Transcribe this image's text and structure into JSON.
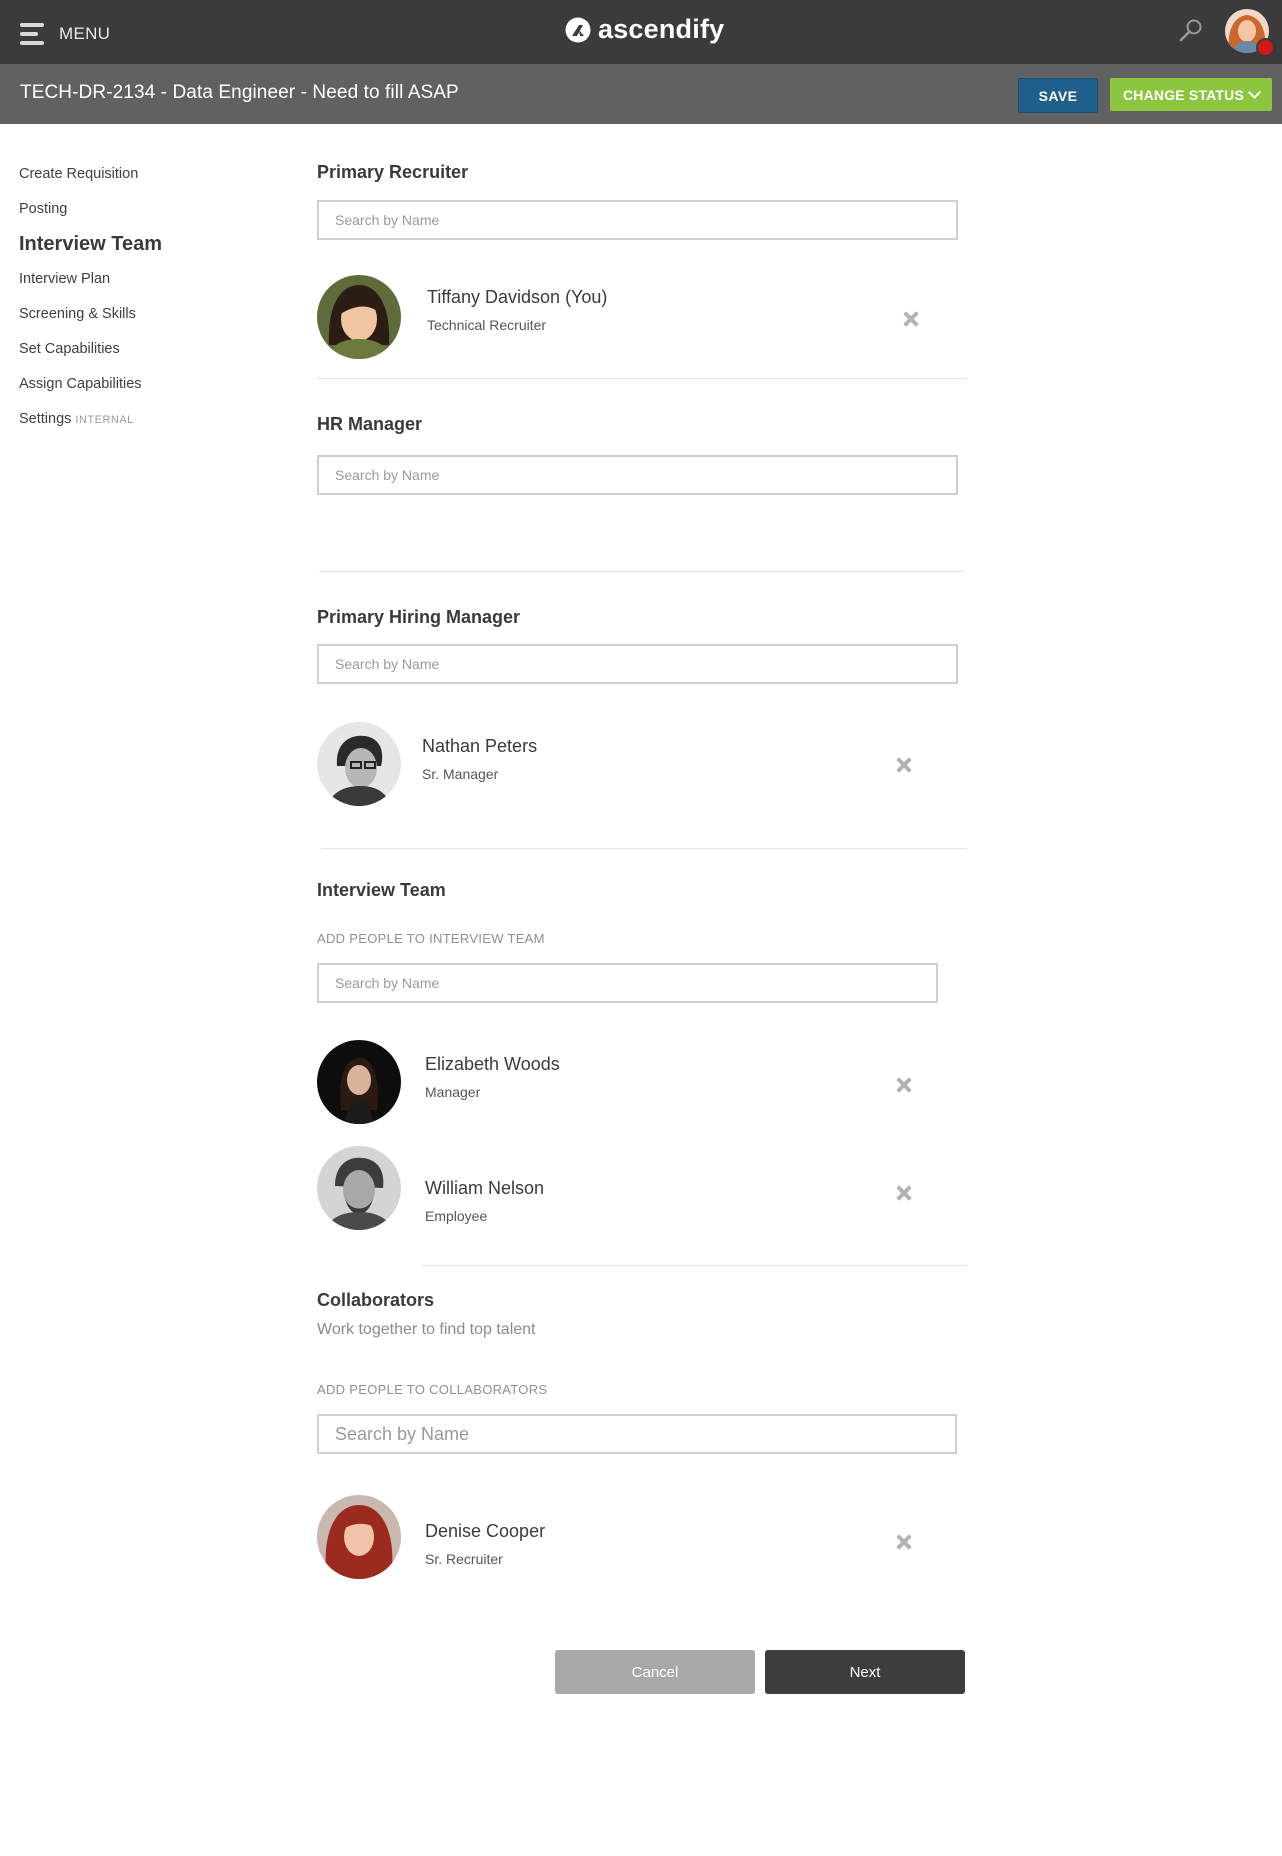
{
  "header": {
    "menu_label": "MENU",
    "brand_name": "ascendify",
    "icons": [
      "hamburger-menu-icon",
      "ascendify-logo-icon",
      "search-icon",
      "user-avatar",
      "notification-dot"
    ]
  },
  "titlebar": {
    "title": "TECH-DR-2134 - Data Engineer - Need to fill ASAP",
    "save_label": "SAVE",
    "change_status_label": "CHANGE STATUS"
  },
  "sidebar": {
    "items": [
      {
        "label": "Create Requisition"
      },
      {
        "label": "Posting"
      },
      {
        "label": "Interview Team",
        "active": true
      },
      {
        "label": "Interview Plan"
      },
      {
        "label": "Screening & Skills"
      },
      {
        "label": "Set Capabilities"
      },
      {
        "label": "Assign Capabilities"
      },
      {
        "label": "Settings",
        "tag": "INTERNAL"
      }
    ]
  },
  "sections": {
    "primary_recruiter": {
      "heading": "Primary Recruiter",
      "search_placeholder": "Search by Name",
      "people": [
        {
          "name": "Tiffany Davidson (You)",
          "role": "Technical Recruiter"
        }
      ]
    },
    "hr_manager": {
      "heading": "HR Manager",
      "search_placeholder": "Search by Name"
    },
    "primary_hiring_manager": {
      "heading": "Primary Hiring Manager",
      "search_placeholder": "Search by Name",
      "people": [
        {
          "name": "Nathan Peters",
          "role": "Sr. Manager"
        }
      ]
    },
    "interview_team": {
      "heading": "Interview Team",
      "add_label": "ADD PEOPLE TO INTERVIEW TEAM",
      "search_placeholder": "Search by Name",
      "people": [
        {
          "name": "Elizabeth Woods",
          "role": "Manager"
        },
        {
          "name": "William Nelson",
          "role": "Employee"
        }
      ]
    },
    "collaborators": {
      "heading": "Collaborators",
      "subtitle": "Work together to find top talent",
      "add_label": "ADD PEOPLE TO COLLABORATORS",
      "search_placeholder": "Search by Name",
      "people": [
        {
          "name": "Denise Cooper",
          "role": "Sr. Recruiter"
        }
      ]
    }
  },
  "footer": {
    "cancel_label": "Cancel",
    "next_label": "Next"
  },
  "colors": {
    "topbar": "#3b3b3b",
    "titlebar": "#616161",
    "save": "#1f5f8c",
    "change_status": "#8cc63f",
    "next": "#3d3d3d",
    "cancel": "#a8a8a8"
  }
}
